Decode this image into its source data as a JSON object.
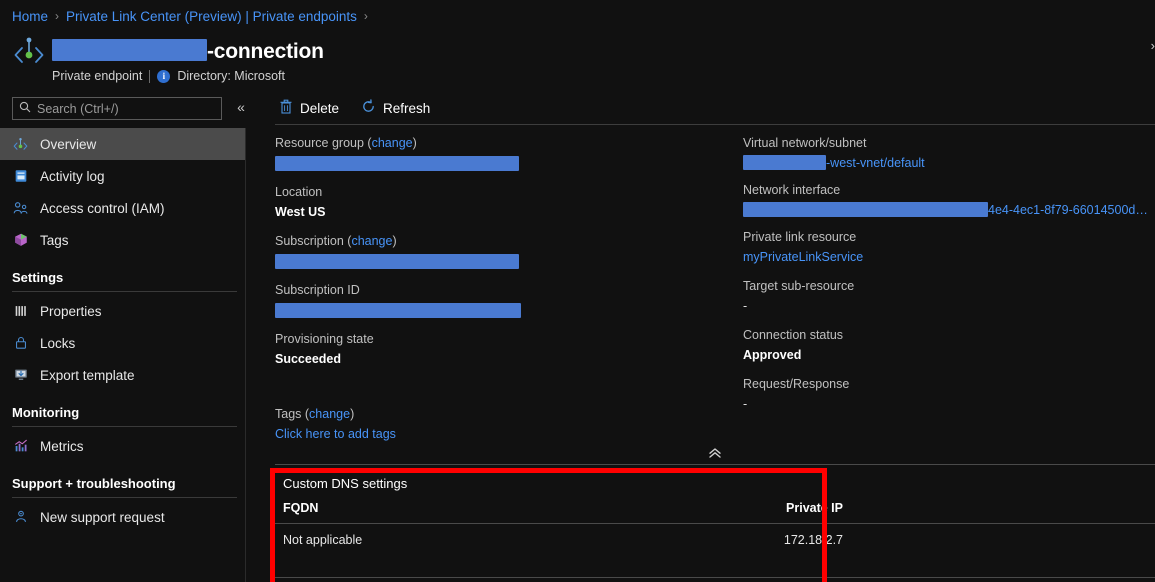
{
  "breadcrumb": {
    "items": [
      {
        "label": "Home",
        "sep": "›"
      },
      {
        "label": "Private Link Center (Preview) | Private endpoints",
        "sep": "›"
      }
    ]
  },
  "header": {
    "title_suffix": "-connection",
    "resource_type": "Private endpoint",
    "directory": "Directory: Microsoft",
    "info_glyph": "i",
    "icon_name": "private-endpoint-icon",
    "edge_chevron": "›"
  },
  "search": {
    "placeholder": "Search (Ctrl+/)",
    "value": "",
    "icon": "search-icon",
    "collapse_glyph": "«"
  },
  "toolbar": {
    "delete_label": "Delete",
    "refresh_label": "Refresh",
    "delete_icon": "trash-icon",
    "refresh_icon": "refresh-icon"
  },
  "sidebar": {
    "items": [
      {
        "label": "Overview",
        "icon": "private-endpoint-icon",
        "selected": true
      },
      {
        "label": "Activity log",
        "icon": "activity-log-icon",
        "selected": false
      },
      {
        "label": "Access control (IAM)",
        "icon": "access-control-icon",
        "selected": false
      },
      {
        "label": "Tags",
        "icon": "tags-icon",
        "selected": false
      }
    ],
    "groups": [
      {
        "title": "Settings",
        "items": [
          {
            "label": "Properties",
            "icon": "properties-icon"
          },
          {
            "label": "Locks",
            "icon": "lock-icon"
          },
          {
            "label": "Export template",
            "icon": "export-template-icon"
          }
        ]
      },
      {
        "title": "Monitoring",
        "items": [
          {
            "label": "Metrics",
            "icon": "metrics-icon"
          }
        ]
      },
      {
        "title": "Support + troubleshooting",
        "items": [
          {
            "label": "New support request",
            "icon": "support-request-icon"
          }
        ]
      }
    ]
  },
  "properties": {
    "left": {
      "resource_group_label": "Resource group",
      "resource_group_change": "change",
      "resource_group_value": "",
      "location_label": "Location",
      "location_value": "West US",
      "subscription_label": "Subscription",
      "subscription_change": "change",
      "subscription_value": "",
      "subscription_id_label": "Subscription ID",
      "subscription_id_value": "",
      "provisioning_state_label": "Provisioning state",
      "provisioning_state_value": "Succeeded"
    },
    "right": {
      "vnet_label": "Virtual network/subnet",
      "vnet_value_suffix": "-west-vnet/default",
      "nic_label": "Network interface",
      "nic_value_suffix": "4e4-4ec1-8f79-66014500d…",
      "private_link_label": "Private link resource",
      "private_link_value": "myPrivateLinkService",
      "target_sub_label": "Target sub-resource",
      "target_sub_value": "-",
      "connection_status_label": "Connection status",
      "connection_status_value": "Approved",
      "request_response_label": "Request/Response",
      "request_response_value": "-"
    }
  },
  "tags": {
    "label": "Tags",
    "change": "change",
    "link": "Click here to add tags"
  },
  "collapse": {
    "glyph": "˄"
  },
  "dns": {
    "title": "Custom DNS settings",
    "columns": [
      "FQDN",
      "Private IP"
    ],
    "rows": [
      {
        "fqdn": "Not applicable",
        "private_ip": "172.18.2.7"
      }
    ]
  },
  "colors": {
    "accent_link": "#4894f8",
    "redaction": "#4a7ad1",
    "highlight_box": "#ff0000",
    "selected_nav": "#4b4b4b",
    "page_bg": "#111111"
  }
}
